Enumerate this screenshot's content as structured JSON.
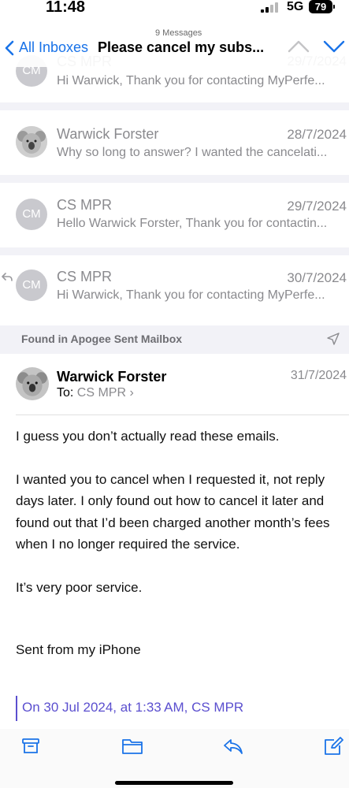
{
  "status_bar": {
    "time": "11:48",
    "network": "5G",
    "battery": "79"
  },
  "nav": {
    "back_label": "All Inboxes",
    "message_count": "9 Messages",
    "subject": "Please cancel my subs..."
  },
  "thread": [
    {
      "initials": "CM",
      "sender": "CS MPR",
      "date": "29/7/2024",
      "preview": "Hi Warwick, Thank you for contacting MyPerfe..."
    },
    {
      "initials": "",
      "sender": "Warwick Forster",
      "date": "28/7/2024",
      "preview": "Why so long to answer? I wanted the cancelati..."
    },
    {
      "initials": "CM",
      "sender": "CS MPR",
      "date": "29/7/2024",
      "preview": "Hello Warwick Forster, Thank you for contactin..."
    },
    {
      "initials": "CM",
      "sender": "CS MPR",
      "date": "30/7/2024",
      "preview": "Hi Warwick, Thank you for contacting MyPerfe..."
    }
  ],
  "found_in": "Found in Apogee Sent Mailbox",
  "open_mail": {
    "sender": "Warwick Forster",
    "to_label": "To:",
    "recipient": "CS MPR",
    "date": "31/7/2024",
    "paragraphs": [
      "I guess you don’t actually read these emails.",
      "I wanted you to cancel when I requested it, not reply days later. I only found out how to cancel it later and found out that I’d been charged another month’s fees when I no longer required the service.",
      "It’s very poor service.",
      "Sent from my iPhone"
    ],
    "quote_line": "On 30 Jul 2024, at 1:33 AM, CS MPR"
  },
  "toolbar": {
    "icons": [
      "archive-icon",
      "folder-icon",
      "reply-icon",
      "compose-icon"
    ]
  },
  "colors": {
    "accent": "#1a73e8",
    "quote": "#5b4fcf",
    "muted": "#8a8a8e"
  }
}
